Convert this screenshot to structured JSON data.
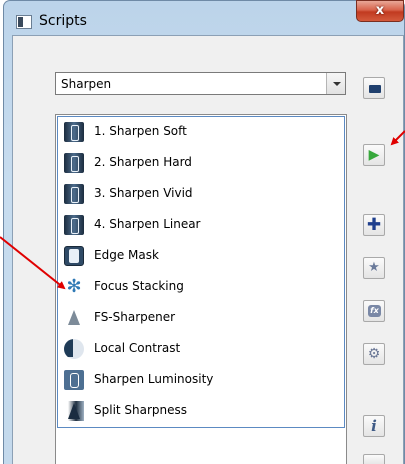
{
  "window": {
    "title": "Scripts",
    "close_label": "x"
  },
  "dropdown": {
    "selected": "Sharpen"
  },
  "scripts": [
    {
      "label": "1. Sharpen Soft",
      "icon": "sharpen-soft-icon"
    },
    {
      "label": "2. Sharpen Hard",
      "icon": "sharpen-hard-icon"
    },
    {
      "label": "3. Sharpen Vivid",
      "icon": "sharpen-vivid-icon"
    },
    {
      "label": "4. Sharpen Linear",
      "icon": "sharpen-linear-icon"
    },
    {
      "label": "Edge Mask",
      "icon": "edge-mask-icon"
    },
    {
      "label": "Focus Stacking",
      "icon": "focus-stacking-icon"
    },
    {
      "label": "FS-Sharpener",
      "icon": "fs-sharpener-icon"
    },
    {
      "label": "Local Contrast",
      "icon": "local-contrast-icon"
    },
    {
      "label": "Sharpen Luminosity",
      "icon": "sharpen-luminosity-icon"
    },
    {
      "label": "Split Sharpness",
      "icon": "split-sharpness-icon"
    }
  ],
  "toolbar": {
    "buttons": [
      "folder-icon",
      "play-icon",
      "plus-icon",
      "star-icon",
      "fx-icon",
      "gear-icon",
      "info-icon"
    ]
  },
  "colors": {
    "annotation_arrow": "#e00000",
    "play": "#37a83c",
    "selection_border": "#5c8ac2"
  }
}
